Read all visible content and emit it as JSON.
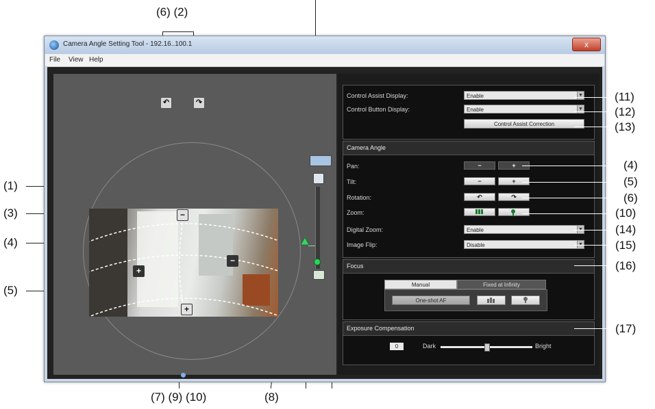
{
  "window": {
    "title": "Camera Angle Setting Tool - 192.16..100.1",
    "close_glyph": "x",
    "menu": [
      "File",
      "View",
      "Help"
    ]
  },
  "callouts": {
    "top_62": "(6) (2)",
    "bottom_7910": "(7) (9) (10)",
    "bottom_8": "(8)",
    "left": [
      "(1)",
      "(3)",
      "(4)",
      "(5)"
    ],
    "right": [
      "(11)",
      "(12)",
      "(13)",
      "(4)",
      "(5)",
      "(6)",
      "(10)",
      "(14)",
      "(15)",
      "(16)",
      "(17)"
    ]
  },
  "settings": {
    "control_assist_display_label": "Control Assist Display:",
    "control_assist_display_value": "Enable",
    "control_button_display_label": "Control Button Display:",
    "control_button_display_value": "Enable",
    "control_assist_correction_button": "Control Assist Correction"
  },
  "camera_angle": {
    "title": "Camera Angle",
    "pan_label": "Pan:",
    "tilt_label": "Tilt:",
    "rotation_label": "Rotation:",
    "zoom_label": "Zoom:",
    "digital_zoom_label": "Digital Zoom:",
    "digital_zoom_value": "Enable",
    "image_flip_label": "Image Flip:",
    "image_flip_value": "Disable"
  },
  "focus": {
    "title": "Focus",
    "tab_manual": "Manual",
    "tab_fixed": "Fixed at Infinity",
    "one_shot_af": "One-shot AF"
  },
  "exposure": {
    "title": "Exposure Compensation",
    "value": "0",
    "dark_label": "Dark",
    "bright_label": "Bright",
    "level": 0.5
  },
  "icons": {
    "minus": "−",
    "plus": "+",
    "rotate_left": "↶",
    "rotate_right": "↷",
    "dropdown": "▼"
  }
}
